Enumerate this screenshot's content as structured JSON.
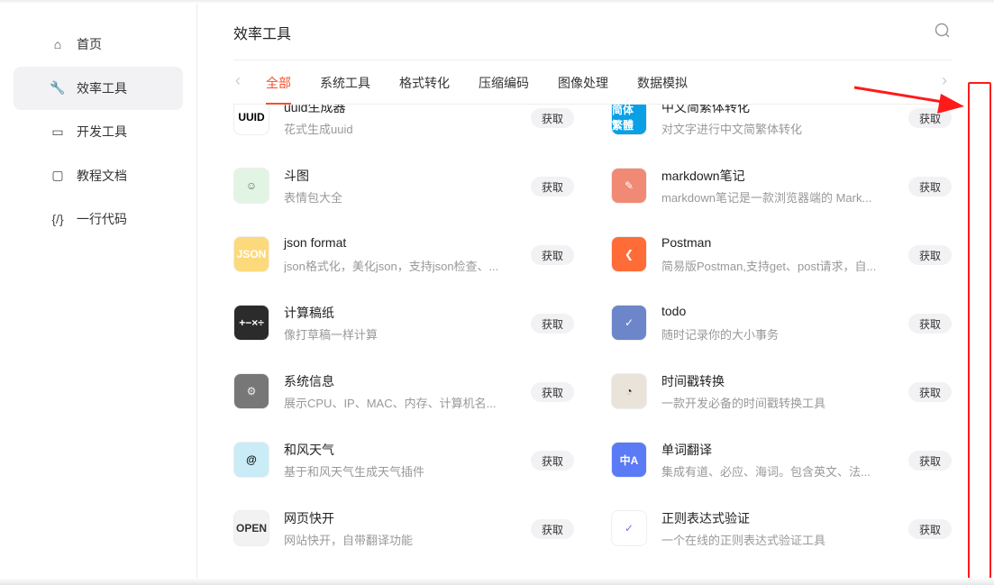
{
  "sidebar": {
    "items": [
      {
        "label": "首页",
        "icon": "home-icon",
        "glyph": "⌂"
      },
      {
        "label": "效率工具",
        "icon": "wrench-icon",
        "glyph": "🔧",
        "active": true
      },
      {
        "label": "开发工具",
        "icon": "toolbox-icon",
        "glyph": "▭"
      },
      {
        "label": "教程文档",
        "icon": "monitor-icon",
        "glyph": "▢"
      },
      {
        "label": "一行代码",
        "icon": "code-icon",
        "glyph": "{/}"
      }
    ]
  },
  "header": {
    "title": "效率工具"
  },
  "tabs": [
    "全部",
    "系统工具",
    "格式转化",
    "压缩编码",
    "图像处理",
    "数据模拟"
  ],
  "active_tab": "全部",
  "get_label": "获取",
  "accent": "#f0532d",
  "annotation_color": "#ff1a1a",
  "tools": [
    {
      "name": "uuid生成器",
      "desc": "花式生成uuid",
      "icon_text": "UUID",
      "bg": "#ffffff",
      "fg": "#000"
    },
    {
      "name": "中文简繁体转化",
      "desc": "对文字进行中文简繁体转化",
      "icon_text": "简体 繁體",
      "bg": "#0aa0e6",
      "fg": "#fff"
    },
    {
      "name": "斗图",
      "desc": "表情包大全",
      "icon_text": "☺",
      "bg": "#e2f5e4",
      "fg": "#666"
    },
    {
      "name": "markdown笔记",
      "desc": "markdown笔记是一款浏览器端的 Mark...",
      "icon_text": "✎",
      "bg": "#f08a75",
      "fg": "#fff"
    },
    {
      "name": "json format",
      "desc": "json格式化，美化json，支持json检查、...",
      "icon_text": "JSON",
      "bg": "#fcd97a",
      "fg": "#fff"
    },
    {
      "name": "Postman",
      "desc": "简易版Postman,支持get、post请求，自...",
      "icon_text": "❮",
      "bg": "#ff6c37",
      "fg": "#fff"
    },
    {
      "name": "计算稿纸",
      "desc": "像打草稿一样计算",
      "icon_text": "+−×÷",
      "bg": "#2b2b2b",
      "fg": "#fff"
    },
    {
      "name": "todo",
      "desc": "随时记录你的大小事务",
      "icon_text": "✓",
      "bg": "#6c86c9",
      "fg": "#fff"
    },
    {
      "name": "系统信息",
      "desc": "展示CPU、IP、MAC、内存、计算机名...",
      "icon_text": "⚙",
      "bg": "#777",
      "fg": "#eee"
    },
    {
      "name": "时间戳转换",
      "desc": "一款开发必备的时间戳转换工具",
      "icon_text": "◔",
      "bg": "#e9e3da",
      "fg": "#222"
    },
    {
      "name": "和风天气",
      "desc": "基于和风天气生成天气插件",
      "icon_text": "@",
      "bg": "#c9ecf7",
      "fg": "#111"
    },
    {
      "name": "单词翻译",
      "desc": "集成有道、必应、海词。包含英文、法...",
      "icon_text": "中A",
      "bg": "#5a7bf5",
      "fg": "#fff"
    },
    {
      "name": "网页快开",
      "desc": "网站快开，自带翻译功能",
      "icon_text": "OPEN",
      "bg": "#f2f2f2",
      "fg": "#333"
    },
    {
      "name": "正则表达式验证",
      "desc": "一个在线的正则表达式验证工具",
      "icon_text": "✓",
      "bg": "#ffffff",
      "fg": "#7a73f0"
    }
  ]
}
